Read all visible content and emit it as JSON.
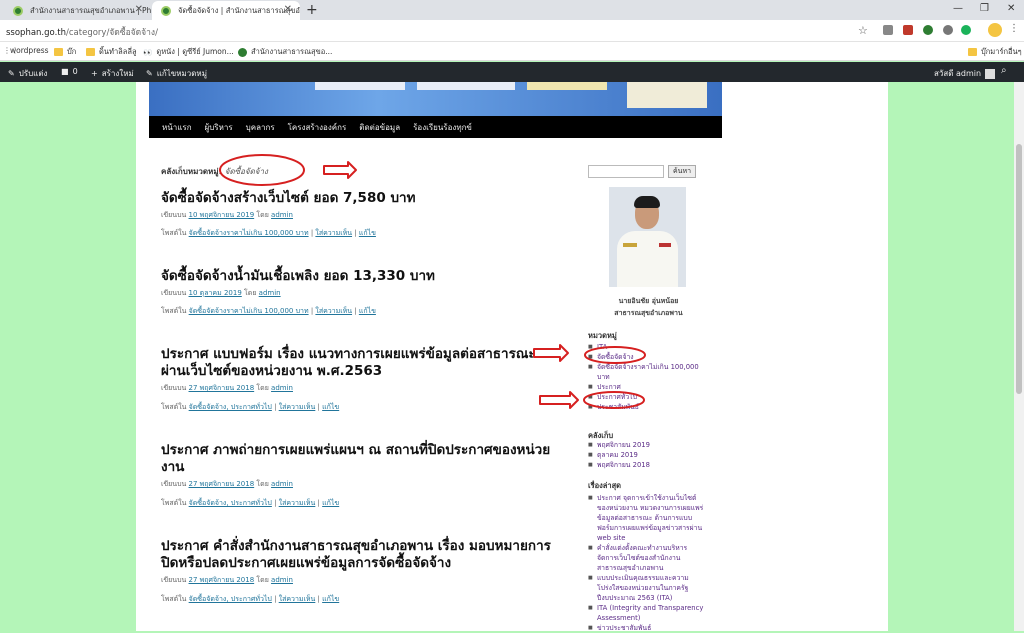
{
  "browser": {
    "tabs": [
      {
        "title": "สำนักงานสาธารณสุขอำเภอพาน | Pha"
      },
      {
        "title": "จัดซื้อจัดจ้าง | สำนักงานสาธารณสุขอำ"
      }
    ],
    "url_host": "ssophan.go.th",
    "url_path": "/category/จัดซื้อจัดจ้าง/",
    "bookmarks": [
      "wordpress",
      "บ๊ก",
      "ดิ้นทำลิลลี่ลู",
      "ดูหนัง | ดูซีรีย์ Jumon...",
      "สำนักงานสาธารณสุขอ..."
    ],
    "other_bookmarks": "บุ๊กมาร์กอื่นๆ"
  },
  "adminbar": {
    "customize": "ปรับแต่ง",
    "comments": "0",
    "new": "สร้างใหม่",
    "edit": "แก้ไขหมวดหมู่",
    "greeting": "สวัสดี admin"
  },
  "nav": [
    "หน้าแรก",
    "ผู้บริหาร",
    "บุคลากร",
    "โครงสร้างองค์กร",
    "ติดต่อข้อมูล",
    "ร้องเรียนร้องทุกข์"
  ],
  "archive": {
    "label": "คลังเก็บหมวดหมู่:",
    "category": "จัดซื้อจัดจ้าง"
  },
  "posts": [
    {
      "title": "จัดซื้อจัดจ้างสร้างเว็บไซต์ ยอด 7,580 บาท",
      "date": "10 พฤศจิกายน 2019",
      "cats": "จัดซื้อจัดจ้างราคาไม่เกิน 100,000 บาท"
    },
    {
      "title": "จัดซื้อจัดจ้างน้ำมันเชื้อเพลิง ยอด 13,330 บาท",
      "date": "10 ตุลาคม 2019",
      "cats": "จัดซื้อจัดจ้างราคาไม่เกิน 100,000 บาท"
    },
    {
      "title": "ประกาศ แบบฟอร์ม เรื่อง แนวทางการเผยแพร่ข้อมูลต่อสาธารณะผ่านเว็บไซต์ของหน่วยงาน พ.ศ.2563",
      "date": "27 พฤศจิกายน 2018",
      "cats": "จัดซื้อจัดจ้าง, ประกาศทั่วไป"
    },
    {
      "title": "ประกาศ ภาพถ่ายการเผยแพร่แผนฯ ณ สถานที่ปิดประกาศของหน่วยงาน",
      "date": "27 พฤศจิกายน 2018",
      "cats": "จัดซื้อจัดจ้าง, ประกาศทั่วไป"
    },
    {
      "title": "ประกาศ คำสั่งสำนักงานสาธารณสุขอำเภอพาน เรื่อง มอบหมายการปิดหรือปลดประกาศเผยแพร่ข้อมูลการจัดซื้อจัดจ้าง",
      "date": "27 พฤศจิกายน 2018",
      "cats": "จัดซื้อจัดจ้าง, ประกาศทั่วไป"
    }
  ],
  "post_labels": {
    "posted_on": "เขียนบน",
    "by": "โดย",
    "author": "admin",
    "posted_in": "โพสต์ใน",
    "comment": "ใส่ความเห็น",
    "edit": "แก้ไข"
  },
  "sidebar": {
    "search_button": "ค้นหา",
    "person_name": "นายอินชัย อุ่นหน้อย",
    "person_title": "สาธารณสุขอำเภอพาน",
    "categories_title": "หมวดหมู่",
    "categories": [
      "ITA",
      "จัดซื้อจัดจ้าง",
      "จัดซื้อจัดจ้างราคาไม่เกิน 100,000 บาท",
      "ประกาศ",
      "ประกาศทั่วไป",
      "ประชาสัมพันธ์"
    ],
    "archives_title": "คลังเก็บ",
    "archives": [
      "พฤศจิกายน 2019",
      "ตุลาคม 2019",
      "พฤศจิกายน 2018"
    ],
    "recent_title": "เรื่องล่าสุด",
    "recent": [
      "ประกาศ จุดการเข้าใช้งานเว็บไซต์ของหน่วยงาน หมวดงานการเผยแพร่ข้อมูลต่อสาธารณะ ด้านการแบบฟอร์มการเผยแพร่ข้อมูลข่าวสารผ่าน web site",
      "คำสั่งแต่งตั้งคณะทำงานบริหารจัดการเว็บไซต์ของสำนักงานสาธารณสุขอำเภอพาน",
      "แบบประเมินคุณธรรมและความโปร่งใสของหน่วยงานในภาครัฐ ปีงบประมาณ 2563 (ITA)",
      "ITA (Integrity and Transparency Assessment)",
      "ข่าวประชาสัมพันธ์"
    ]
  },
  "colors": {
    "annotation": "#d62020",
    "bg": "#b4f5b8"
  }
}
